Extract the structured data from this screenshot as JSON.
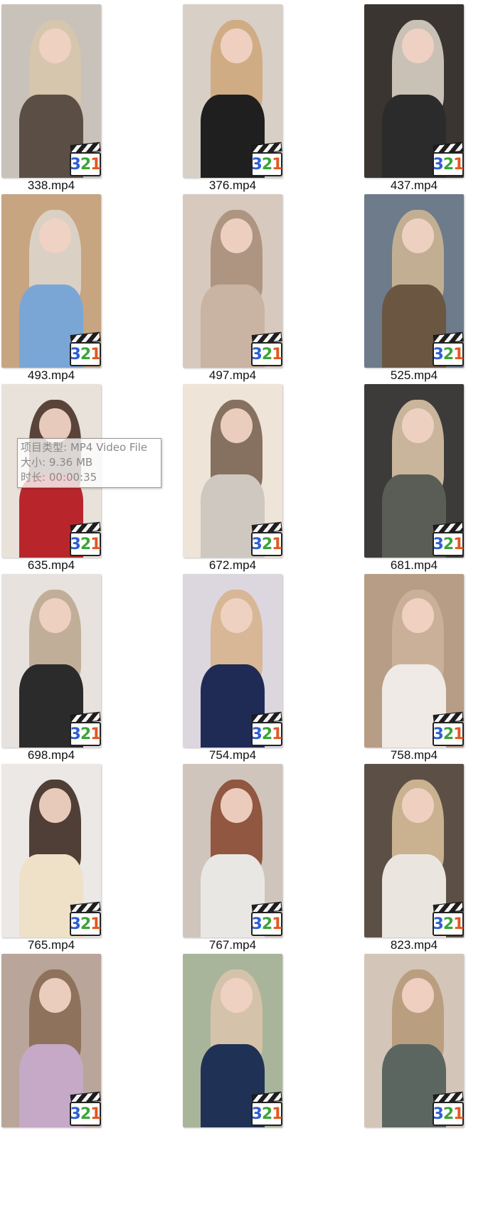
{
  "files": [
    {
      "name": "338.mp4",
      "thumb": {
        "bg": "#c9c2ba",
        "hair": "#d7c6ad",
        "body": "#5b4f45"
      }
    },
    {
      "name": "376.mp4",
      "thumb": {
        "bg": "#d8cfc6",
        "hair": "#cfa77d",
        "body": "#1f1f1f"
      }
    },
    {
      "name": "437.mp4",
      "thumb": {
        "bg": "#3a3530",
        "hair": "#d9cfc5",
        "body": "#2b2b2b"
      }
    },
    {
      "name": "493.mp4",
      "thumb": {
        "bg": "#c7a581",
        "hair": "#ddd5cb",
        "body": "#7aa6d6"
      }
    },
    {
      "name": "497.mp4",
      "thumb": {
        "bg": "#d8c9be",
        "hair": "#a88f7a",
        "body": "#c9b3a3"
      }
    },
    {
      "name": "525.mp4",
      "thumb": {
        "bg": "#6d7b8a",
        "hair": "#cbb493",
        "body": "#6b5641"
      }
    },
    {
      "name": "635.mp4",
      "thumb": {
        "bg": "#e8e2da",
        "hair": "#4a3328",
        "body": "#b8262c"
      }
    },
    {
      "name": "672.mp4",
      "thumb": {
        "bg": "#efe4d8",
        "hair": "#7a6454",
        "body": "#cfc8c0"
      }
    },
    {
      "name": "681.mp4",
      "thumb": {
        "bg": "#3d3a3a",
        "hair": "#d8c3a6",
        "body": "#5a5d55"
      }
    },
    {
      "name": "698.mp4",
      "thumb": {
        "bg": "#e7e2dd",
        "hair": "#bca891",
        "body": "#2b2b2b"
      }
    },
    {
      "name": "754.mp4",
      "thumb": {
        "bg": "#dcd6df",
        "hair": "#d6b48d",
        "body": "#1f2b55"
      }
    },
    {
      "name": "758.mp4",
      "thumb": {
        "bg": "#b79d86",
        "hair": "#cdb39b",
        "body": "#efeae6"
      }
    },
    {
      "name": "765.mp4",
      "thumb": {
        "bg": "#ece8e6",
        "hair": "#3f2c22",
        "body": "#efe1c8"
      }
    },
    {
      "name": "767.mp4",
      "thumb": {
        "bg": "#cfc5bc",
        "hair": "#8a4a33",
        "body": "#e9e7e3"
      }
    },
    {
      "name": "823.mp4",
      "thumb": {
        "bg": "#5c5046",
        "hair": "#d6bc98",
        "body": "#eae6df"
      }
    },
    {
      "name": "",
      "thumb": {
        "bg": "#b9a59a",
        "hair": "#8a6d55",
        "body": "#c6a9c6"
      }
    },
    {
      "name": "",
      "thumb": {
        "bg": "#a9b59a",
        "hair": "#d8c4ac",
        "body": "#1f3256"
      }
    },
    {
      "name": "",
      "thumb": {
        "bg": "#d3c6b8",
        "hair": "#b7997a",
        "body": "#5b6660"
      }
    }
  ],
  "badge_digits": [
    "3",
    "2",
    "1"
  ],
  "tooltip": {
    "type_line": "项目类型: MP4 Video File",
    "size_line": "大小: 9.36 MB",
    "duration_line": "时长: 00:00:35"
  }
}
